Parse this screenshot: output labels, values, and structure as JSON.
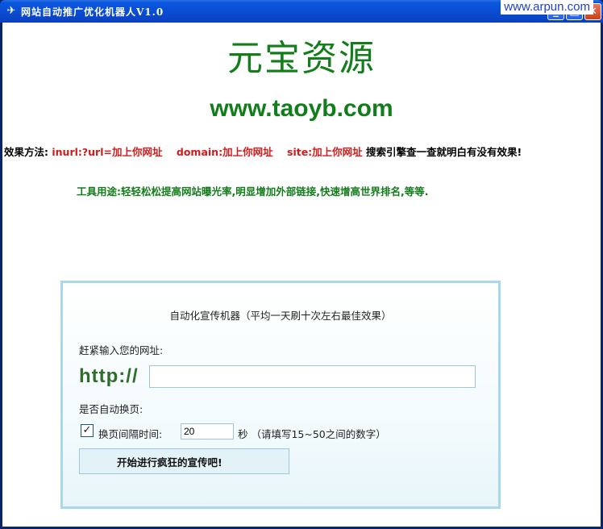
{
  "window": {
    "title": "网站自动推广优化机器人V1.0",
    "watermark": "www.arpun.com",
    "controls": {
      "minimize": "_",
      "maximize": "□",
      "close": "✕"
    }
  },
  "brand": {
    "name": "元宝资源",
    "url": "www.taoyb.com"
  },
  "method": {
    "prefix": "效果方法:",
    "q1": "inurl:?url=加上你网址",
    "q2": "domain:加上你网址",
    "q3": "site:加上你网址",
    "suffix": "搜索引擎查一查就明白有没有效果!"
  },
  "purpose": "工具用途:轻轻松松提高网站曝光率,明显增加外部链接,快速增高世界排名,等等.",
  "panel": {
    "title": "自动化宣传机器（平均一天刷十次左右最佳效果）",
    "url_label": "赶紧输入您的网址:",
    "http_prefix": "http://",
    "url_value": "",
    "auto_label": "是否自动换页:",
    "auto_checked_mark": "✓",
    "interval_label": "换页间隔时间:",
    "interval_value": "20",
    "interval_suffix": "秒 （请填写15~50之间的数字）",
    "start_button": "开始进行疯狂的宣传吧!"
  }
}
